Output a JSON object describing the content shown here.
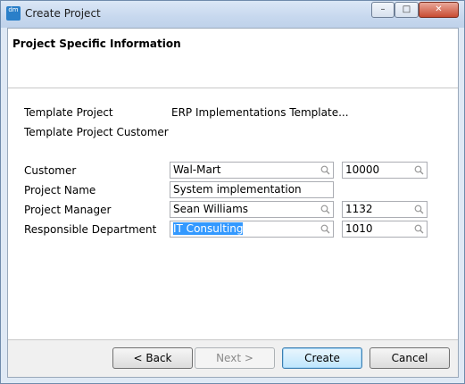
{
  "window": {
    "title": "Create Project",
    "app_icon_text": "dm",
    "controls": {
      "minimize": "–",
      "maximize": "□",
      "close": "✕"
    }
  },
  "header": {
    "title": "Project Specific Information"
  },
  "template": {
    "project_label": "Template Project",
    "project_value": "ERP Implementations Template...",
    "customer_label": "Template Project Customer",
    "customer_value": ""
  },
  "form": {
    "customer": {
      "label": "Customer",
      "name": "Wal-Mart",
      "id": "10000"
    },
    "project_name": {
      "label": "Project Name",
      "value": "System implementation"
    },
    "project_manager": {
      "label": "Project Manager",
      "name": "Sean Williams",
      "id": "1132"
    },
    "department": {
      "label": "Responsible Department",
      "name": "IT Consulting",
      "id": "1010"
    }
  },
  "buttons": {
    "back": "< Back",
    "next": "Next >",
    "create": "Create",
    "cancel": "Cancel"
  },
  "icons": {
    "lookup": "search-icon"
  },
  "colors": {
    "selection": "#3399ff",
    "default_button_border": "#3c7fb1"
  }
}
